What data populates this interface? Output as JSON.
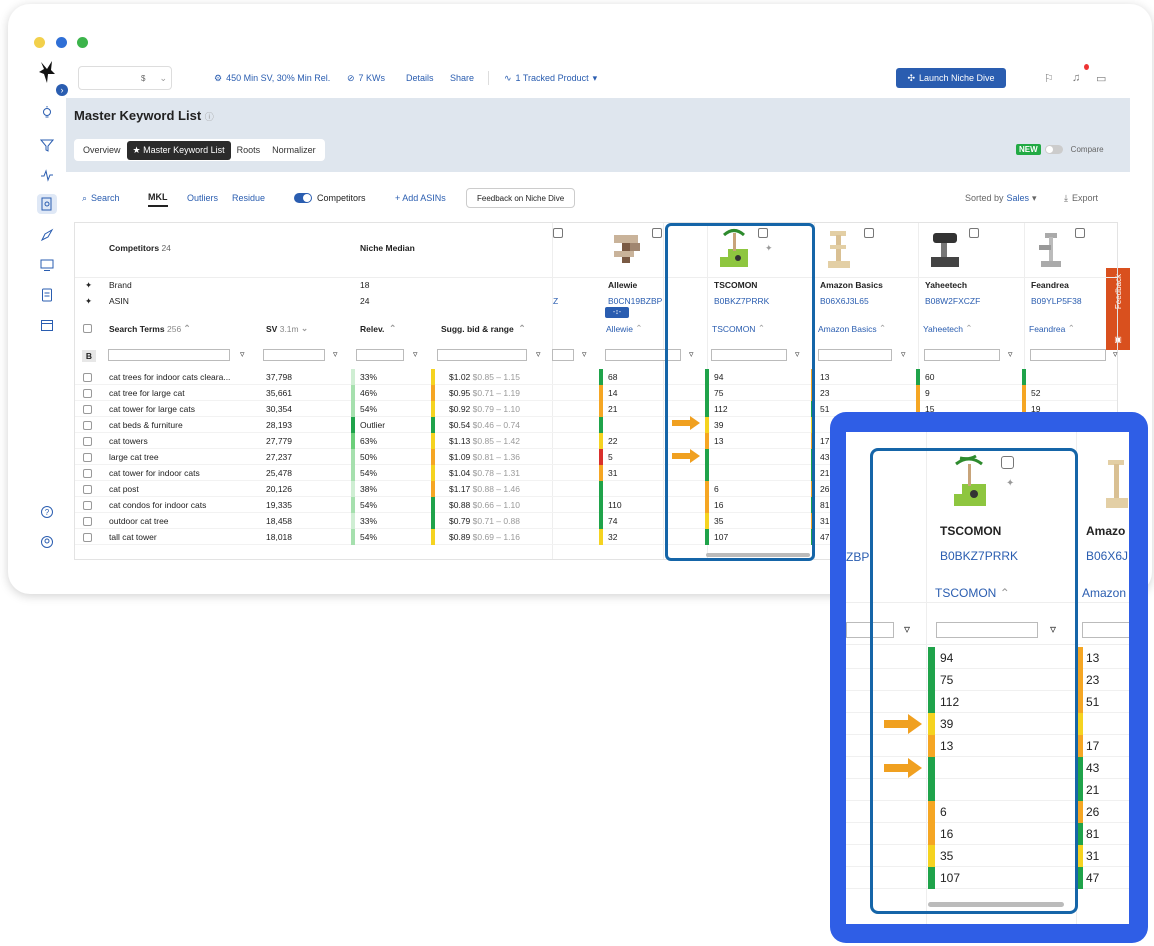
{
  "topbar": {
    "sv_filter": "450 Min SV, 30% Min Rel.",
    "kws": "7 KWs",
    "details": "Details",
    "share": "Share",
    "tracked": "1 Tracked Product",
    "launch": "Launch Niche Dive",
    "select_value": "$"
  },
  "page": {
    "title": "Master Keyword List",
    "tabs": [
      "Overview",
      "Master Keyword List",
      "Roots",
      "Normalizer"
    ],
    "new_badge": "NEW",
    "compare": "Compare"
  },
  "toolbar": {
    "search": "Search",
    "mkl": "MKL",
    "outliers": "Outliers",
    "residue": "Residue",
    "competitors": "Competitors",
    "add_asins": "+ Add ASINs",
    "feedback_btn": "Feedback on Niche Dive",
    "sorted_by": "Sorted by",
    "sorted_field": "Sales",
    "export": "Export"
  },
  "feedback_tab": "Feedback",
  "grid": {
    "competitors_label": "Competitors",
    "competitors_count": "24",
    "niche_median": "Niche Median",
    "brand_label": "Brand",
    "brand_median": "18",
    "asin_label": "ASIN",
    "asin_median": "24",
    "search_terms": "Search Terms",
    "search_terms_count": "256",
    "sv": "SV",
    "sv_total": "3.1m",
    "relev": "Relev.",
    "sugg": "Sugg. bid & range",
    "b_label": "B",
    "partial_asin": "Z",
    "competitor_cols": [
      {
        "brand": "Allewie",
        "asin": "B0CN19BZBP",
        "label": "Allewie"
      },
      {
        "brand": "TSCOMON",
        "asin": "B0BKZ7PRRK",
        "label": "TSCOMON"
      },
      {
        "brand": "Amazon Basics",
        "asin": "B06X6J3L65",
        "label": "Amazon Basics"
      },
      {
        "brand": "Yaheetech",
        "asin": "B08W2FXCZF",
        "label": "Yaheetech"
      },
      {
        "brand": "Feandrea",
        "asin": "B09YLP5F38",
        "label": "Feandrea"
      }
    ],
    "rows": [
      {
        "term": "cat trees for indoor cats cleara...",
        "sv": "37,798",
        "rel": "33%",
        "bid": "$1.02",
        "range": "$0.85 – 1.15",
        "c": [
          "68",
          "94",
          "13",
          "60",
          ""
        ]
      },
      {
        "term": "cat tree for large cat",
        "sv": "35,661",
        "rel": "46%",
        "bid": "$0.95",
        "range": "$0.71 – 1.19",
        "c": [
          "14",
          "75",
          "23",
          "9",
          "52"
        ]
      },
      {
        "term": "cat tower for large cats",
        "sv": "30,354",
        "rel": "54%",
        "bid": "$0.92",
        "range": "$0.79 – 1.10",
        "c": [
          "21",
          "112",
          "51",
          "15",
          "19"
        ]
      },
      {
        "term": "cat beds & furniture",
        "sv": "28,193",
        "rel": "Outlier",
        "bid": "$0.54",
        "range": "$0.46 – 0.74",
        "c": [
          "",
          "39",
          "",
          "",
          ""
        ]
      },
      {
        "term": "cat towers",
        "sv": "27,779",
        "rel": "63%",
        "bid": "$1.13",
        "range": "$0.85 – 1.42",
        "c": [
          "22",
          "13",
          "17",
          "",
          ""
        ]
      },
      {
        "term": "large cat tree",
        "sv": "27,237",
        "rel": "50%",
        "bid": "$1.09",
        "range": "$0.81 – 1.36",
        "c": [
          "5",
          "",
          "43",
          "",
          ""
        ]
      },
      {
        "term": "cat tower for indoor cats",
        "sv": "25,478",
        "rel": "54%",
        "bid": "$1.04",
        "range": "$0.78 – 1.31",
        "c": [
          "31",
          "",
          "21",
          "",
          ""
        ]
      },
      {
        "term": "cat post",
        "sv": "20,126",
        "rel": "38%",
        "bid": "$1.17",
        "range": "$0.88 – 1.46",
        "c": [
          "",
          "6",
          "26",
          "",
          ""
        ]
      },
      {
        "term": "cat condos for indoor cats",
        "sv": "19,335",
        "rel": "54%",
        "bid": "$0.88",
        "range": "$0.66 – 1.10",
        "c": [
          "110",
          "16",
          "81",
          "",
          ""
        ]
      },
      {
        "term": "outdoor cat tree",
        "sv": "18,458",
        "rel": "33%",
        "bid": "$0.79",
        "range": "$0.71 – 0.88",
        "c": [
          "74",
          "35",
          "31",
          "",
          ""
        ]
      },
      {
        "term": "tall cat tower",
        "sv": "18,018",
        "rel": "54%",
        "bid": "$0.89",
        "range": "$0.69 – 1.16",
        "c": [
          "32",
          "107",
          "47",
          "",
          ""
        ]
      }
    ]
  },
  "zoom": {
    "brand": "TSCOMON",
    "asin": "B0BKZ7PRRK",
    "label": "TSCOMON",
    "partial_left": "ZBP",
    "partial_right_brand": "Amazo",
    "partial_right_asin": "B06X6J",
    "partial_right_label": "Amazon",
    "values": [
      "94",
      "75",
      "112",
      "39",
      "13",
      "",
      "",
      "6",
      "16",
      "35",
      "107"
    ],
    "right_values": [
      "13",
      "23",
      "51",
      "",
      "17",
      "43",
      "21",
      "26",
      "81",
      "31",
      "47"
    ]
  }
}
